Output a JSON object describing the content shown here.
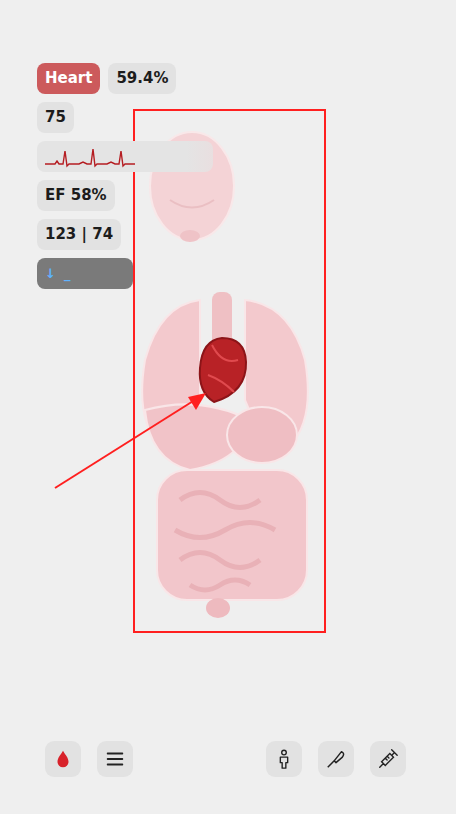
{
  "organ": {
    "label": "Heart",
    "selected": true
  },
  "share": "59.4%",
  "heart_rate": "75",
  "ejection_fraction": "EF 58%",
  "blood_pressure": "123 | 74",
  "trend": {
    "arrow": "↓",
    "text": "_"
  }
}
